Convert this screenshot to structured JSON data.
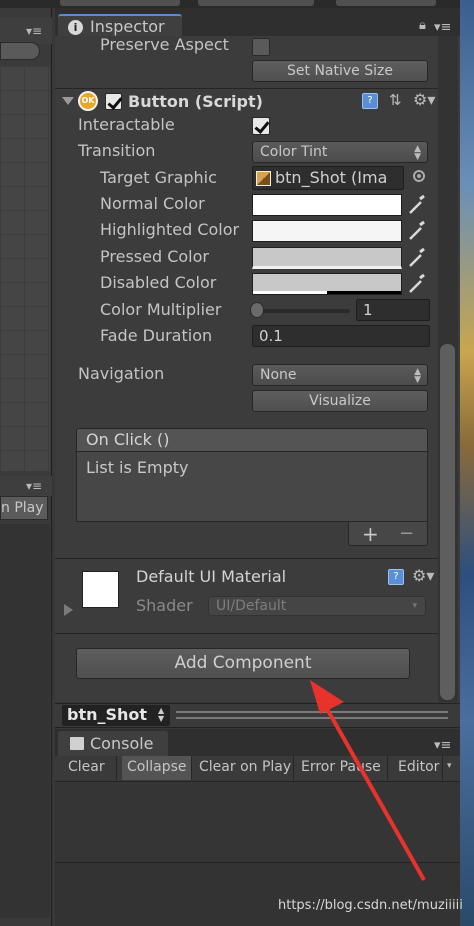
{
  "inspector": {
    "tab_label": "Inspector",
    "preserve_aspect_label": "Preserve Aspect",
    "preserve_aspect_checked": false,
    "set_native_size_label": "Set Native Size"
  },
  "button_component": {
    "title": "Button (Script)",
    "enabled": true,
    "interactable_label": "Interactable",
    "interactable_checked": true,
    "transition_label": "Transition",
    "transition_value": "Color Tint",
    "target_graphic_label": "Target Graphic",
    "target_graphic_value": "btn_Shot (Ima",
    "normal_color_label": "Normal Color",
    "highlighted_color_label": "Highlighted Color",
    "pressed_color_label": "Pressed Color",
    "disabled_color_label": "Disabled Color",
    "color_multiplier_label": "Color Multiplier",
    "color_multiplier_value": "1",
    "fade_duration_label": "Fade Duration",
    "fade_duration_value": "0.1",
    "navigation_label": "Navigation",
    "navigation_value": "None",
    "visualize_label": "Visualize",
    "on_click_label": "On Click ()",
    "list_empty_label": "List is Empty",
    "add_label": "+",
    "remove_label": "−",
    "colors": {
      "normal": "#ffffff",
      "highlighted": "#f5f5f5",
      "pressed": "#c8c8c8",
      "disabled": "#c8c8c8"
    }
  },
  "material": {
    "title": "Default UI Material",
    "shader_label": "Shader",
    "shader_value": "UI/Default"
  },
  "add_component_label": "Add Component",
  "object_bar": {
    "name": "btn_Shot"
  },
  "left_panel": {
    "play_label": "n Play"
  },
  "console": {
    "tab_label": "Console",
    "toolbar": [
      "Clear",
      "Collapse",
      "Clear on Play",
      "Error Pause",
      "Editor"
    ]
  },
  "watermark": "https://blog.csdn.net/muziiiii",
  "accent_arrow_color": "#e8322c"
}
